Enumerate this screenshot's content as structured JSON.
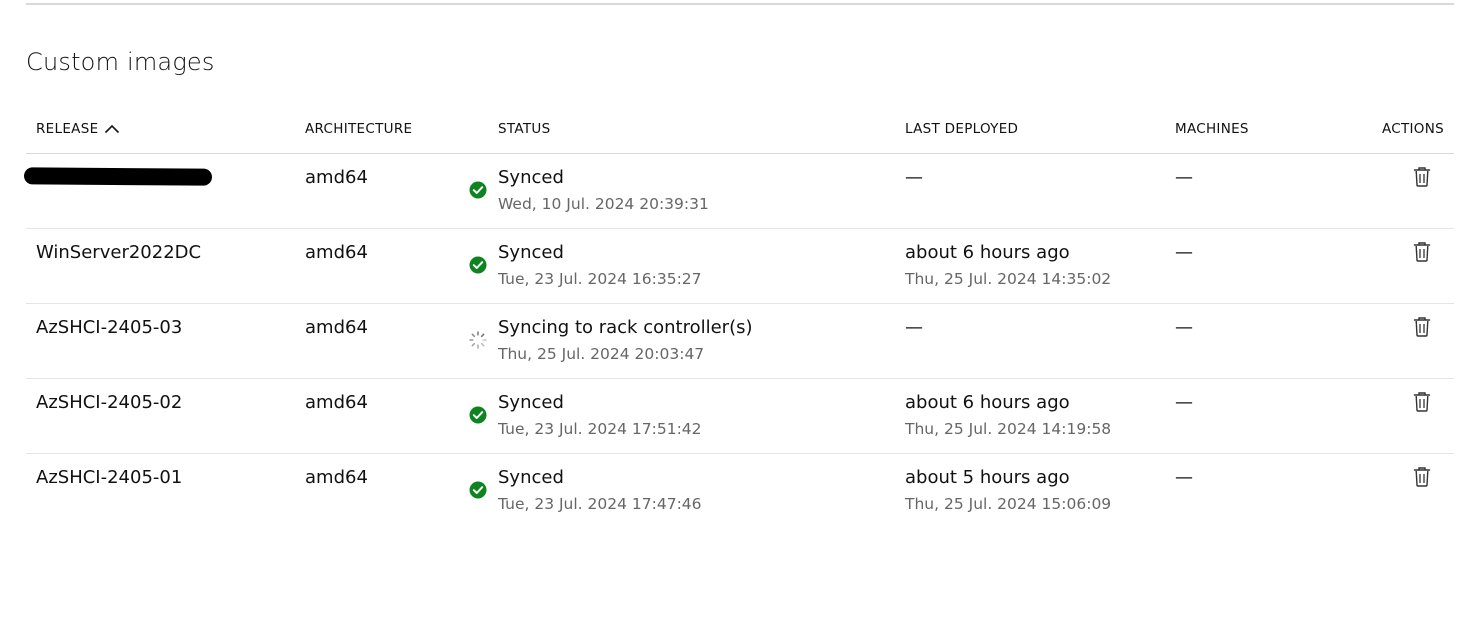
{
  "section": {
    "title": "Custom images"
  },
  "table": {
    "columns": {
      "release": "RELEASE",
      "architecture": "ARCHITECTURE",
      "status": "STATUS",
      "last_deployed": "LAST DEPLOYED",
      "machines": "MACHINES",
      "actions": "ACTIONS"
    },
    "sort_icon": "chevron-up-icon",
    "rows": [
      {
        "release": "",
        "release_redacted": true,
        "architecture": "amd64",
        "status": "Synced",
        "status_icon": "success-check-icon",
        "status_time": "Wed, 10 Jul. 2024 20:39:31",
        "last_deployed": "—",
        "last_deployed_time": "",
        "machines": "—"
      },
      {
        "release": "WinServer2022DC",
        "architecture": "amd64",
        "status": "Synced",
        "status_icon": "success-check-icon",
        "status_time": "Tue, 23 Jul. 2024 16:35:27",
        "last_deployed": "about 6 hours ago",
        "last_deployed_time": "Thu, 25 Jul. 2024 14:35:02",
        "machines": "—"
      },
      {
        "release": "AzSHCI-2405-03",
        "architecture": "amd64",
        "status": "Syncing to rack controller(s)",
        "status_icon": "syncing-spinner-icon",
        "status_time": "Thu, 25 Jul. 2024 20:03:47",
        "last_deployed": "—",
        "last_deployed_time": "",
        "machines": "—"
      },
      {
        "release": "AzSHCI-2405-02",
        "architecture": "amd64",
        "status": "Synced",
        "status_icon": "success-check-icon",
        "status_time": "Tue, 23 Jul. 2024 17:51:42",
        "last_deployed": "about 6 hours ago",
        "last_deployed_time": "Thu, 25 Jul. 2024 14:19:58",
        "machines": "—"
      },
      {
        "release": "AzSHCI-2405-01",
        "architecture": "amd64",
        "status": "Synced",
        "status_icon": "success-check-icon",
        "status_time": "Tue, 23 Jul. 2024 17:47:46",
        "last_deployed": "about 5 hours ago",
        "last_deployed_time": "Thu, 25 Jul. 2024 15:06:09",
        "machines": "—"
      }
    ]
  },
  "colors": {
    "success": "#0e8420",
    "spinner": "#666666",
    "secondary_text": "#666666",
    "divider": "#d9d9d9"
  }
}
